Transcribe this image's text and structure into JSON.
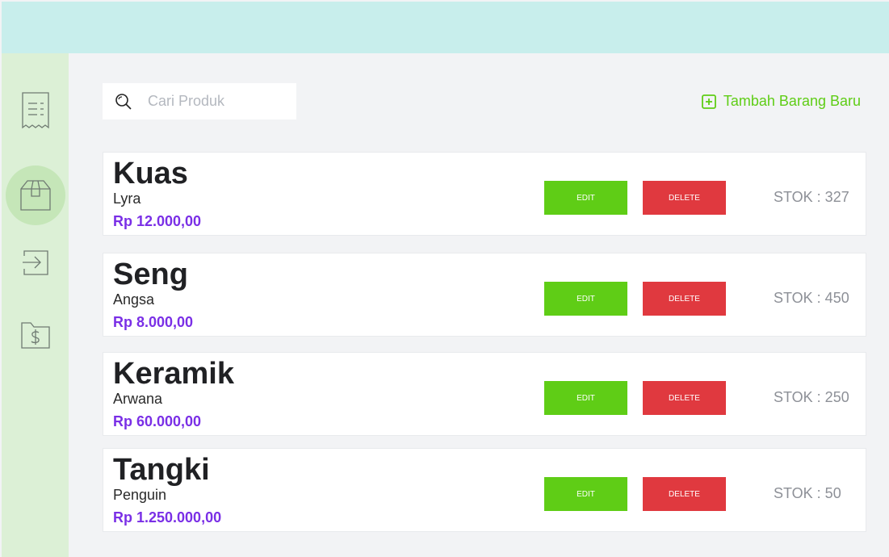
{
  "search": {
    "placeholder": "Cari Produk",
    "value": ""
  },
  "add_button": {
    "label": "Tambah Barang Baru"
  },
  "sidebar": {
    "items": [
      {
        "name": "receipt-icon",
        "active": false
      },
      {
        "name": "box-icon",
        "active": true
      },
      {
        "name": "login-icon",
        "active": false
      },
      {
        "name": "money-folder-icon",
        "active": false
      }
    ]
  },
  "products": [
    {
      "name": "Kuas",
      "brand": "Lyra",
      "price": "Rp 12.000,00",
      "stock": "STOK : 327",
      "edit_label": "EDIT",
      "delete_label": "DELETE"
    },
    {
      "name": "Seng",
      "brand": "Angsa",
      "price": "Rp 8.000,00",
      "stock": "STOK : 450",
      "edit_label": "EDIT",
      "delete_label": "DELETE"
    },
    {
      "name": "Keramik",
      "brand": "Arwana",
      "price": "Rp 60.000,00",
      "stock": "STOK : 250",
      "edit_label": "EDIT",
      "delete_label": "DELETE"
    },
    {
      "name": "Tangki",
      "brand": "Penguin",
      "price": "Rp 1.250.000,00",
      "stock": "STOK : 50",
      "edit_label": "EDIT",
      "delete_label": "DELETE"
    }
  ],
  "colors": {
    "topbar": "#c8eeec",
    "sidebar": "#dcf0d6",
    "accent_green": "#5fcd16",
    "danger_red": "#e0393f",
    "price_purple": "#7a2fe6"
  }
}
